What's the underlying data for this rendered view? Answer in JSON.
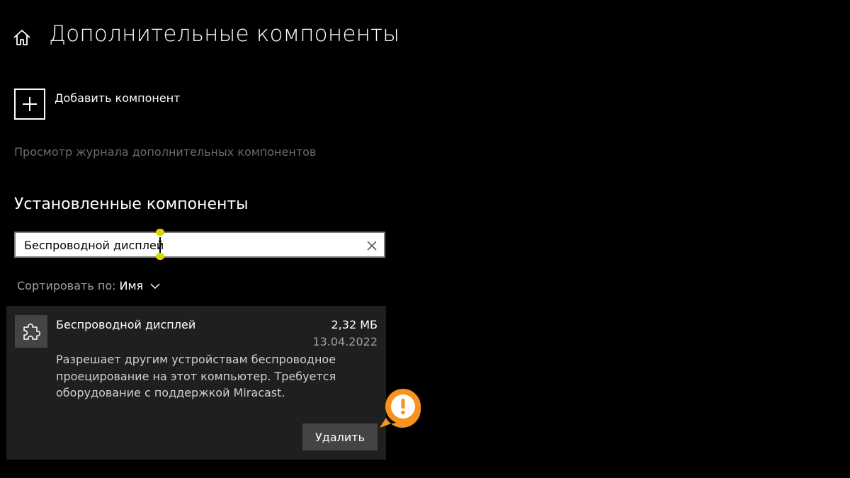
{
  "header": {
    "title": "Дополнительные компоненты",
    "home_icon": "home-icon"
  },
  "add_component": {
    "label": "Добавить компонент",
    "icon": "plus-icon"
  },
  "history_link": "Просмотр журнала дополнительных компонентов",
  "installed": {
    "title": "Установленные компоненты",
    "search": {
      "value": "Беспроводной дисплей",
      "clear_icon": "close-icon"
    },
    "sort": {
      "label": "Сортировать по:",
      "value": "Имя"
    },
    "items": [
      {
        "name": "Беспроводной дисплей",
        "size": "2,32 МБ",
        "date": "13.04.2022",
        "description": "Разрешает другим устройствам беспроводное проецирование на этот компьютер. Требуется оборудование с поддержкой Miracast.",
        "remove_label": "Удалить",
        "icon": "puzzle-icon"
      }
    ]
  },
  "colors": {
    "background": "#000000",
    "card": "#1f1f1f",
    "button": "#444444",
    "muted_text": "#6b6b6b",
    "warning_accent": "#f7931e",
    "selection_handle": "#d8d800"
  }
}
